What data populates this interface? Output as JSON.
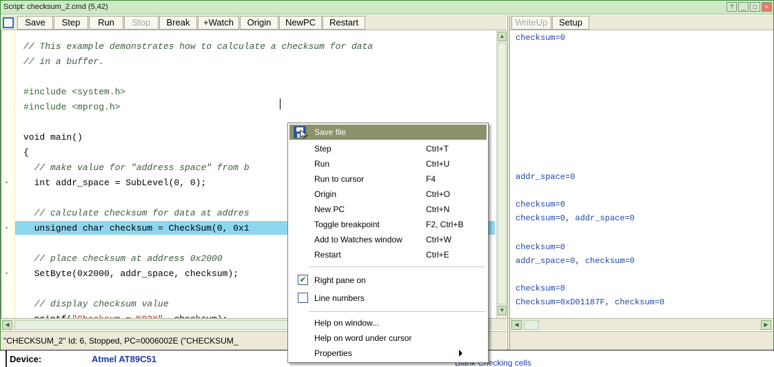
{
  "window": {
    "title": "Script: checksum_2.cmd (5,42)"
  },
  "toolbar": {
    "buttons": [
      "Save",
      "Step",
      "Run",
      "Stop",
      "Break",
      "+Watch",
      "Origin",
      "NewPC",
      "Restart"
    ],
    "disabled": [
      "Stop"
    ]
  },
  "right_toolbar": {
    "buttons": [
      "WriteUp",
      "Setup"
    ],
    "disabled": [
      "WriteUp"
    ]
  },
  "code_lines": [
    "// This example demonstrates how to calculate a checksum for data",
    "// in a buffer.",
    "",
    "#include <system.h>",
    "#include <mprog.h>",
    "",
    "void main()",
    "{",
    "  // make value for \"address space\" from b",
    "  int addr_space = SubLevel(0, 0);",
    "",
    "  // calculate checksum for data at addres",
    "  unsigned char checksum = CheckSum(0, 0x1",
    "",
    "  // place checksum at address 0x2000",
    "  SetByte(0x2000, addr_space, checksum);",
    "",
    "  // display checksum value",
    "  printf(\"Checksum = %02X\", checksum);"
  ],
  "highlighted_line": 12,
  "right_pane": {
    "lines": [
      "checksum=0",
      "addr_space=0",
      "checksum=0",
      "checksum=0, addr_space=0",
      "checksum=0",
      "addr_space=0, checksum=0",
      "checksum=0",
      "Checksum=0xD01187F, checksum=0"
    ]
  },
  "status": {
    "text": "\"CHECKSUM_2\" Id: 6, Stopped, PC=0006002E (\"CHECKSUM_"
  },
  "bottom": {
    "device_label": "Device:",
    "device_value": "Atmel AT89C51",
    "blank_label": "Blank Checking cells"
  },
  "context_menu": {
    "items": [
      {
        "label": "Save file",
        "shortcut": "",
        "selected": true,
        "icon": "save-icon"
      },
      {
        "label": "Step",
        "shortcut": "Ctrl+T"
      },
      {
        "label": "Run",
        "shortcut": "Ctrl+U"
      },
      {
        "label": "Run to cursor",
        "shortcut": "F4"
      },
      {
        "label": "Origin",
        "shortcut": "Ctrl+O"
      },
      {
        "label": "New PC",
        "shortcut": "Ctrl+N"
      },
      {
        "label": "Toggle breakpoint",
        "shortcut": "F2, Ctrl+B"
      },
      {
        "label": "Add to Watches window",
        "shortcut": "Ctrl+W"
      },
      {
        "label": "Restart",
        "shortcut": "Ctrl+E"
      }
    ],
    "checks": [
      {
        "label": "Right pane on",
        "checked": true
      },
      {
        "label": "Line numbers",
        "checked": false
      }
    ],
    "help": [
      {
        "label": "Help on window..."
      },
      {
        "label": "Help on word under cursor"
      },
      {
        "label": "Properties",
        "submenu": true
      }
    ]
  },
  "colors": {
    "highlight": "#8ed6ee",
    "menu_selection": "#8a926a",
    "titlebar": "#cfe8c6",
    "right_pane_text": "#1c44a8"
  }
}
